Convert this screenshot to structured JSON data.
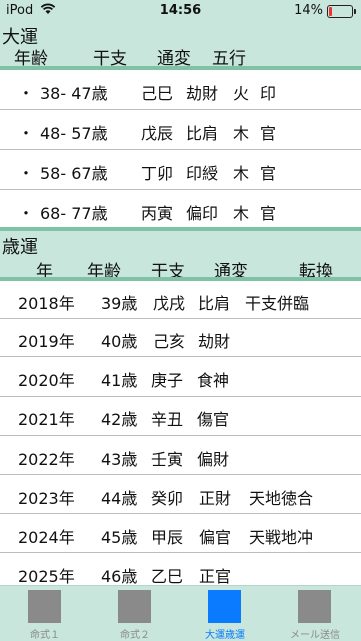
{
  "status_bar": {
    "device": "iPod",
    "time": "14:56",
    "battery_percent": "14%",
    "battery_level": 0.14
  },
  "daiun": {
    "title": "大運",
    "columns": {
      "age": "年齢",
      "kanshi": "干支",
      "tsuhen": "通変",
      "gogyo": "五行"
    },
    "rows": [
      {
        "bullet": "・",
        "age": "38- 47歳",
        "kanshi": "己巳",
        "tsuhen": "劫財",
        "gogyo1": "火",
        "gogyo2": "印"
      },
      {
        "bullet": "・",
        "age": "48- 57歳",
        "kanshi": "戊辰",
        "tsuhen": "比肩",
        "gogyo1": "木",
        "gogyo2": "官"
      },
      {
        "bullet": "・",
        "age": "58- 67歳",
        "kanshi": "丁卯",
        "tsuhen": "印綬",
        "gogyo1": "木",
        "gogyo2": "官"
      },
      {
        "bullet": "・",
        "age": "68- 77歳",
        "kanshi": "丙寅",
        "tsuhen": "偏印",
        "gogyo1": "木",
        "gogyo2": "官"
      }
    ]
  },
  "saiun": {
    "title": "歳運",
    "columns": {
      "year": "年",
      "age": "年齢",
      "kanshi": "干支",
      "tsuhen": "通変",
      "tenkan": "転換"
    },
    "rows": [
      {
        "year": "2018年",
        "age": "39歳",
        "kanshi": "戊戌",
        "tsuhen": "比肩",
        "tenkan": "干支併臨"
      },
      {
        "year": "2019年",
        "age": "40歳",
        "kanshi": "己亥",
        "tsuhen": "劫財",
        "tenkan": ""
      },
      {
        "year": "2020年",
        "age": "41歳",
        "kanshi": "庚子",
        "tsuhen": "食神",
        "tenkan": ""
      },
      {
        "year": "2021年",
        "age": "42歳",
        "kanshi": "辛丑",
        "tsuhen": "傷官",
        "tenkan": ""
      },
      {
        "year": "2022年",
        "age": "43歳",
        "kanshi": "壬寅",
        "tsuhen": "偏財",
        "tenkan": ""
      },
      {
        "year": "2023年",
        "age": "44歳",
        "kanshi": "癸卯",
        "tsuhen": "正財",
        "tenkan": "天地徳合"
      },
      {
        "year": "2024年",
        "age": "45歳",
        "kanshi": "甲辰",
        "tsuhen": "偏官",
        "tenkan": "天戦地冲"
      },
      {
        "year": "2025年",
        "age": "46歳",
        "kanshi": "乙巳",
        "tsuhen": "正官",
        "tenkan": ""
      }
    ]
  },
  "tabs": [
    {
      "label": "命式１",
      "active": false
    },
    {
      "label": "命式２",
      "active": false
    },
    {
      "label": "大運歳運",
      "active": true
    },
    {
      "label": "メール送信",
      "active": false
    }
  ],
  "colors": {
    "header_bg": "#c8e6dc",
    "accent_rule": "#7fc2a8",
    "active_tab": "#0a7bff",
    "inactive_tab": "#8a8a8a",
    "battery_low": "#e33"
  }
}
